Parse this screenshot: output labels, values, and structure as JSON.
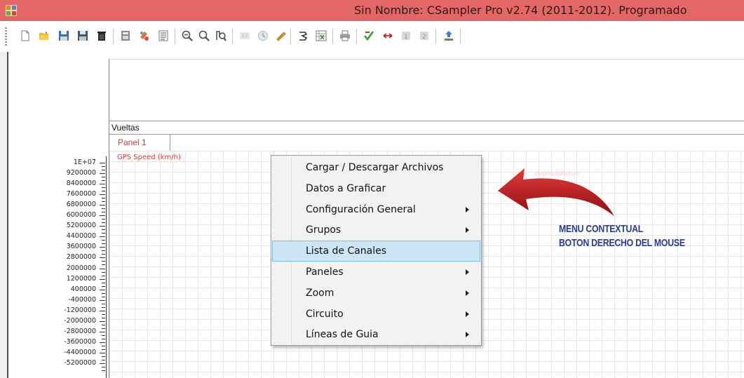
{
  "window": {
    "title": "Sin Nombre: CSampler Pro v2.74 (2011-2012). Programado",
    "titlebar_color": "#e26766"
  },
  "toolbar": {
    "buttons": [
      "new-file-icon",
      "open-folder-icon",
      "save-icon",
      "save-as-icon",
      "delete-icon",
      "calculator-icon",
      "paint-icon",
      "list-icon",
      "zoom-out-icon",
      "zoom-in-icon",
      "zoom-fit-icon",
      "numeric-icon",
      "clock-icon",
      "ruler-icon",
      "track-icon",
      "spreadsheet-icon",
      "print-icon",
      "check-icon",
      "horizontal-arrows-icon",
      "marker-1-icon",
      "marker-2-icon",
      "upload-icon"
    ]
  },
  "sections": {
    "laps_label": "Vueltas",
    "panel_tab": "Panel 1"
  },
  "chart": {
    "channel_label": "GPS Speed (km/h)",
    "grid": true
  },
  "chart_data": {
    "type": "line",
    "title": "",
    "ylabel": "GPS Speed (km/h)",
    "y_ticks": [
      "1E+07",
      "9200000",
      "8400000",
      "7600000",
      "6800000",
      "6000000",
      "5200000",
      "4400000",
      "3600000",
      "2800000",
      "2000000",
      "1200000",
      "400000",
      "-400000",
      "-1200000",
      "-2000000",
      "-2800000",
      "-3600000",
      "-4400000",
      "-5200000"
    ],
    "series": []
  },
  "context_menu": {
    "items": [
      {
        "label": "Cargar / Descargar Archivos",
        "submenu": false,
        "highlighted": false
      },
      {
        "label": "Datos a Graficar",
        "submenu": false,
        "highlighted": false
      },
      {
        "label": "Configuración General",
        "submenu": true,
        "highlighted": false
      },
      {
        "label": "Grupos",
        "submenu": true,
        "highlighted": false
      },
      {
        "label": "Lista de Canales",
        "submenu": false,
        "highlighted": true
      },
      {
        "label": "Paneles",
        "submenu": true,
        "highlighted": false
      },
      {
        "label": "Zoom",
        "submenu": true,
        "highlighted": false
      },
      {
        "label": "Circuito",
        "submenu": true,
        "highlighted": false
      },
      {
        "label": "Líneas de Guia",
        "submenu": true,
        "highlighted": false
      }
    ],
    "highlight_color": "#cde6f7"
  },
  "annotation": {
    "line1": "MENU CONTEXTUAL",
    "line2": "BOTON DERECHO DEL MOUSE",
    "text_color": "#2b3a8f",
    "arrow_color": "#c0161b",
    "watermark": "depositphotos"
  }
}
